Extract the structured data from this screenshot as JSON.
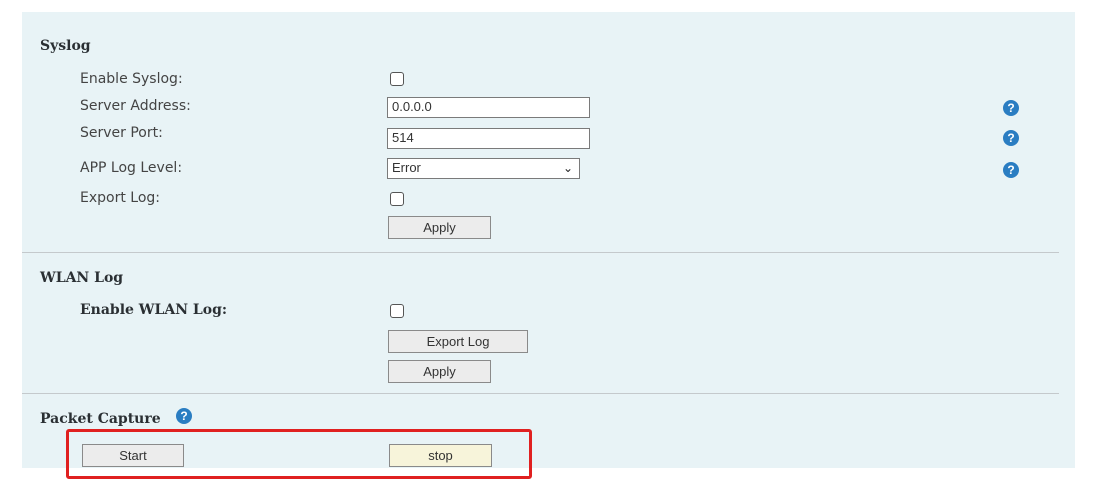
{
  "syslog": {
    "title": "Syslog",
    "enable_label": "Enable Syslog:",
    "server_address_label": "Server Address:",
    "server_address_value": "0.0.0.0",
    "server_port_label": "Server Port:",
    "server_port_value": "514",
    "app_log_level_label": "APP Log Level:",
    "app_log_level_value": "Error",
    "export_log_label": "Export Log:",
    "apply_label": "Apply",
    "help_glyph": "?"
  },
  "wlan": {
    "title": "WLAN Log",
    "enable_label": "Enable WLAN Log:",
    "export_log_button": "Export Log",
    "apply_label": "Apply"
  },
  "packet_capture": {
    "title": "Packet Capture",
    "start_label": "Start",
    "stop_label": "stop",
    "highlight_color": "#e02020"
  },
  "colors": {
    "panel_bg": "#e8f3f6",
    "help_icon": "#2a7dc2"
  }
}
